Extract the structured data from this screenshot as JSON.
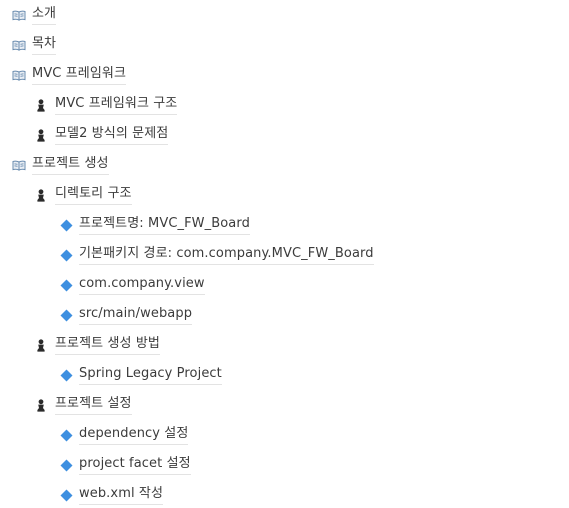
{
  "outline": [
    {
      "level": 0,
      "icon": "book-icon",
      "label": "소개"
    },
    {
      "level": 0,
      "icon": "book-icon",
      "label": "목차"
    },
    {
      "level": 0,
      "icon": "book-icon",
      "label": "MVC 프레임워크"
    },
    {
      "level": 1,
      "icon": "person-icon",
      "label": "MVC 프레임워크 구조"
    },
    {
      "level": 1,
      "icon": "person-icon",
      "label": "모델2 방식의 문제점"
    },
    {
      "level": 0,
      "icon": "book-icon",
      "label": "프로젝트 생성"
    },
    {
      "level": 1,
      "icon": "person-icon",
      "label": "디렉토리 구조"
    },
    {
      "level": 2,
      "icon": "diamond-icon",
      "label": "프로젝트명: MVC_FW_Board"
    },
    {
      "level": 2,
      "icon": "diamond-icon",
      "label": "기본패키지 경로: com.company.MVC_FW_Board"
    },
    {
      "level": 2,
      "icon": "diamond-icon",
      "label": "com.company.view"
    },
    {
      "level": 2,
      "icon": "diamond-icon",
      "label": "src/main/webapp"
    },
    {
      "level": 1,
      "icon": "person-icon",
      "label": "프로젝트 생성 방법"
    },
    {
      "level": 2,
      "icon": "diamond-icon",
      "label": "Spring Legacy Project"
    },
    {
      "level": 1,
      "icon": "person-icon",
      "label": "프로젝트 설정"
    },
    {
      "level": 2,
      "icon": "diamond-icon",
      "label": "dependency 설정"
    },
    {
      "level": 2,
      "icon": "diamond-icon",
      "label": "project facet 설정"
    },
    {
      "level": 2,
      "icon": "diamond-icon",
      "label": "web.xml 작성"
    }
  ],
  "colors": {
    "text": "#3b3b3b",
    "diamond": "#3d8fe0",
    "book": "#6a8caf",
    "person": "#2b2b2b",
    "underline": "#e3e3e3"
  }
}
